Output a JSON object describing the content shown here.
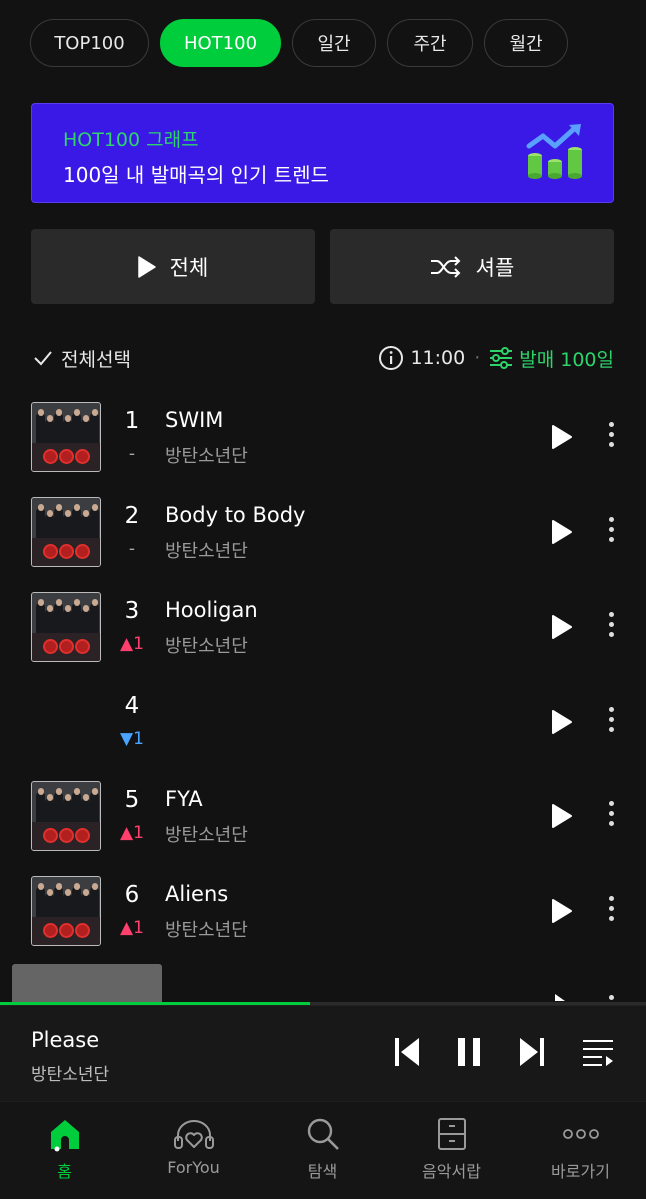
{
  "tabs": [
    {
      "label": "TOP100",
      "active": false
    },
    {
      "label": "HOT100",
      "active": true
    },
    {
      "label": "일간",
      "active": false
    },
    {
      "label": "주간",
      "active": false
    },
    {
      "label": "월간",
      "active": false
    }
  ],
  "banner": {
    "title": "HOT100 그래프",
    "subtitle": "100일 내 발매곡의 인기 트렌드"
  },
  "actions": {
    "play_all": "전체",
    "shuffle": "셔플"
  },
  "list_header": {
    "select_all": "전체선택",
    "time": "11:00",
    "separator": "·",
    "filter": "발매 100일"
  },
  "songs": [
    {
      "rank": "1",
      "change": "-",
      "change_dir": "same",
      "title": "SWIM",
      "artist": "방탄소년단"
    },
    {
      "rank": "2",
      "change": "-",
      "change_dir": "same",
      "title": "Body to Body",
      "artist": "방탄소년단"
    },
    {
      "rank": "3",
      "change": "▲1",
      "change_dir": "up",
      "title": "Hooligan",
      "artist": "방탄소년단"
    },
    {
      "rank": "4",
      "change": "▼1",
      "change_dir": "down",
      "title": "",
      "artist": ""
    },
    {
      "rank": "5",
      "change": "▲1",
      "change_dir": "up",
      "title": "FYA",
      "artist": "방탄소년단"
    },
    {
      "rank": "6",
      "change": "▲1",
      "change_dir": "up",
      "title": "Aliens",
      "artist": "방탄소년단"
    }
  ],
  "now_playing": {
    "title": "Please",
    "artist": "방탄소년단",
    "progress": 0.48
  },
  "nav": [
    {
      "label": "홈",
      "icon": "home-icon",
      "active": true
    },
    {
      "label": "ForYou",
      "icon": "heart-headphones-icon",
      "active": false
    },
    {
      "label": "탐색",
      "icon": "search-icon",
      "active": false
    },
    {
      "label": "음악서랍",
      "icon": "drawer-icon",
      "active": false
    },
    {
      "label": "바로가기",
      "icon": "more-dots-icon",
      "active": false
    }
  ],
  "colors": {
    "accent": "#00cd3c",
    "banner_bg": "#3a19e6",
    "rank_up": "#ff3f6c",
    "rank_down": "#4aa3ff",
    "background": "#121212"
  }
}
